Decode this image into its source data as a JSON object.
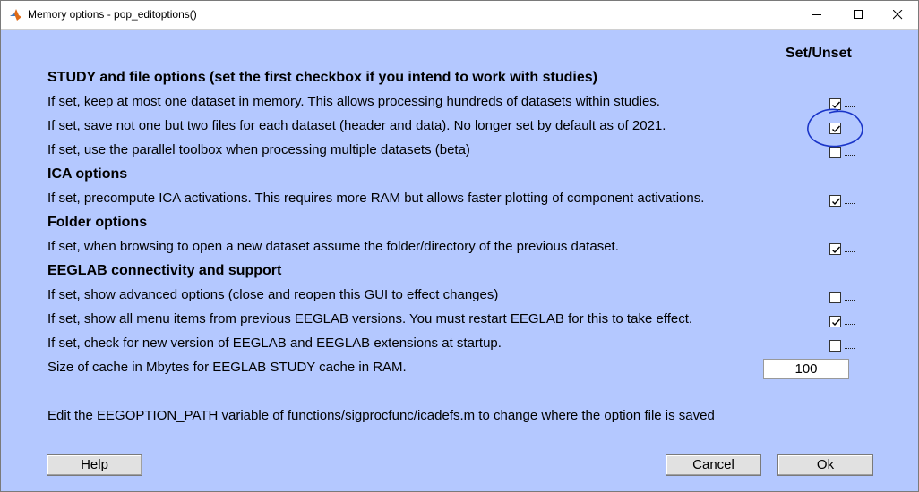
{
  "window": {
    "title": "Memory options - pop_editoptions()"
  },
  "header": {
    "set_unset": "Set/Unset"
  },
  "sections": {
    "study": "STUDY and file options (set the first checkbox if you intend to work with studies)",
    "ica": "ICA options",
    "folder": "Folder options",
    "connectivity": "EEGLAB connectivity and support"
  },
  "options": [
    {
      "label": "If set, keep at most one dataset in memory. This allows processing hundreds of datasets within studies.",
      "checked": true
    },
    {
      "label": "If set, save not one but two files for each dataset (header and data). No longer set by default as of 2021.",
      "checked": true
    },
    {
      "label": "If set, use the parallel toolbox when processing multiple datasets (beta)",
      "checked": false
    },
    {
      "label": "If set, precompute ICA activations. This requires more RAM but allows faster plotting of component activations.",
      "checked": true
    },
    {
      "label": "If set, when browsing to open a new dataset assume the folder/directory of the previous dataset.",
      "checked": true
    },
    {
      "label": "If set, show advanced options (close and reopen this GUI to effect changes)",
      "checked": false
    },
    {
      "label": "If set, show all menu items from previous EEGLAB versions. You must restart EEGLAB for this to take effect.",
      "checked": true
    },
    {
      "label": "If set, check for new version of EEGLAB and EEGLAB extensions at startup.",
      "checked": false
    }
  ],
  "cache": {
    "label": "Size of cache in Mbytes for EEGLAB STUDY cache in RAM.",
    "value": "100"
  },
  "footer_note": "Edit the EEGOPTION_PATH variable of functions/sigprocfunc/icadefs.m to change where the option file is saved",
  "buttons": {
    "help": "Help",
    "cancel": "Cancel",
    "ok": "Ok"
  },
  "colors": {
    "background": "#b4c8ff",
    "button": "#e1e1e1",
    "annotation": "#1a35c8"
  },
  "icons": {
    "app": "matlab-icon",
    "minimize": "minimize-icon",
    "maximize": "maximize-icon",
    "close": "close-icon"
  }
}
